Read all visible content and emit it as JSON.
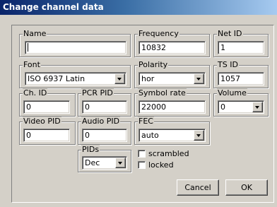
{
  "dialog": {
    "title": "Change channel data"
  },
  "name": {
    "label": "Name",
    "value": ""
  },
  "frequency": {
    "label": "Frequency",
    "value": "10832"
  },
  "net_id": {
    "label": "Net ID",
    "value": "1"
  },
  "font": {
    "label": "Font",
    "value": "ISO 6937 Latin"
  },
  "polarity": {
    "label": "Polarity",
    "value": "hor"
  },
  "ts_id": {
    "label": "TS ID",
    "value": "1057"
  },
  "ch_id": {
    "label": "Ch. ID",
    "value": "0"
  },
  "pcr_pid": {
    "label": "PCR PID",
    "value": "0"
  },
  "symbol_rate": {
    "label": "Symbol rate",
    "value": "22000"
  },
  "volume": {
    "label": "Volume",
    "value": "0"
  },
  "video_pid": {
    "label": "Video PID",
    "value": "0"
  },
  "audio_pid": {
    "label": "Audio PID",
    "value": "0"
  },
  "fec": {
    "label": "FEC",
    "value": "auto"
  },
  "pids": {
    "label": "PIDs",
    "value": "Dec"
  },
  "scrambled": {
    "label": "scrambled",
    "checked": false
  },
  "locked": {
    "label": "locked",
    "checked": false
  },
  "buttons": {
    "cancel": "Cancel",
    "ok": "OK"
  }
}
